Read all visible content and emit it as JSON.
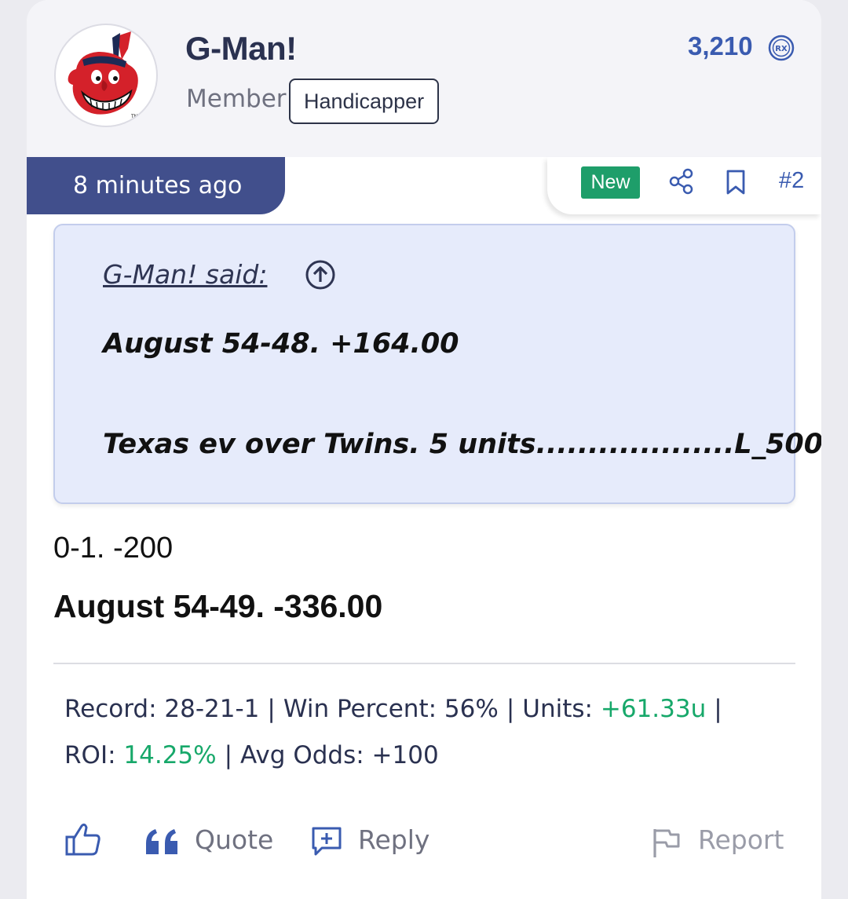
{
  "user": {
    "name": "G-Man!",
    "role": "Member",
    "badge": "Handicapper",
    "points": "3,210",
    "points_icon": "rx-coin-icon",
    "avatar": "cleveland-indians-logo-avatar"
  },
  "post": {
    "timestamp": "8 minutes ago",
    "new_label": "New",
    "number": "#2",
    "quote": {
      "author": "G-Man! said:",
      "line1": "August 54-48. +164.00",
      "line2": "Texas ev over Twins. 5 units...................L_500"
    },
    "body_line1": "0-1. -200",
    "body_line2": "August 54-49. -336.00"
  },
  "stats": {
    "record_label": "Record:",
    "record_value": "28-21-1",
    "win_label": "Win Percent:",
    "win_value": "56%",
    "units_label": "Units:",
    "units_value": "+61.33u",
    "roi_label": "ROI:",
    "roi_value": "14.25%",
    "odds_label": "Avg Odds:",
    "odds_value": "+100"
  },
  "footer": {
    "quote_label": "Quote",
    "reply_label": "Reply",
    "report_label": "Report"
  },
  "colors": {
    "accent": "#3a5bb0",
    "timestamp_bg": "#414f8c",
    "new_badge": "#1e9e6a",
    "positive": "#17a86a",
    "quote_bg": "#e6ebfb"
  }
}
